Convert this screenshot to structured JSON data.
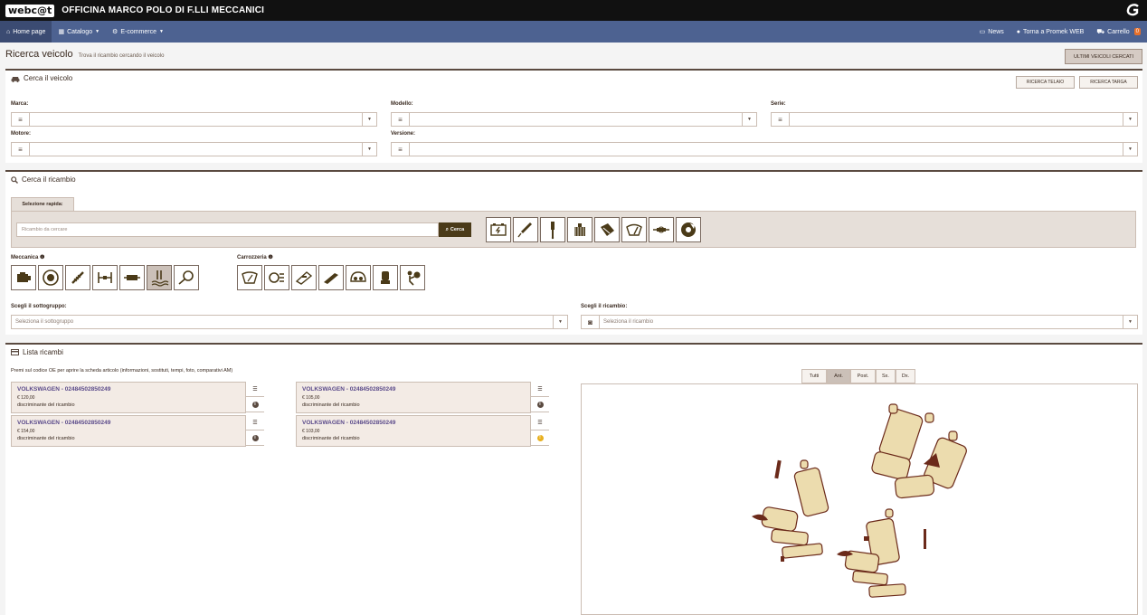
{
  "app": {
    "logo_text": "webc@t",
    "title": "OFFICINA MARCO POLO DI F.LLI MECCANICI"
  },
  "nav": {
    "home": "Home page",
    "catalogo": "Catalogo",
    "ecommerce": "E-commerce",
    "news": "News",
    "torna": "Torna a Promek WEB",
    "carrello": "Carrello",
    "cart_count": "0"
  },
  "page": {
    "title": "Ricerca veicolo",
    "subtitle": "Trova il ricambio cercando il veicolo",
    "last_button": "ULTIMI VEICOLI CERCATI"
  },
  "vehicle": {
    "title": "Cerca il veicolo",
    "btn_telaio": "RICERCA TELAIO",
    "btn_targa": "RICERCA TARGA",
    "marca": "Marca:",
    "modello": "Modello:",
    "serie": "Serie:",
    "motore": "Motore:",
    "versione": "Versione:"
  },
  "part_search": {
    "title": "Cerca il ricambio",
    "quick_tab": "Selezione rapida:",
    "placeholder": "Ricambio da cercare",
    "search_btn": "Cerca",
    "meccanica": "Meccanica",
    "carrozzeria": "Carrozzeria",
    "sottogruppo_label": "Scegli il sottogruppo:",
    "sottogruppo_placeholder": "Seleziona il sottogruppo",
    "ricambio_label": "Scegli il ricambio:",
    "ricambio_placeholder": "Seleziona il ricambio"
  },
  "list": {
    "title": "Lista ricambi",
    "hint": "Premi sul codice OE per aprire la scheda articolo (informazioni, sostituti, tempi, foto, comparativi AM)",
    "items": [
      {
        "title": "VOLKSWAGEN - 02484502850249",
        "price": "€ 120,00",
        "desc": "discriminante del ricambio"
      },
      {
        "title": "VOLKSWAGEN - 02484502850249",
        "price": "€ 105,00",
        "desc": "discriminante del ricambio"
      },
      {
        "title": "VOLKSWAGEN - 02484502850249",
        "price": "€ 154,00",
        "desc": "discriminante del ricambio"
      },
      {
        "title": "VOLKSWAGEN - 02484502850249",
        "price": "€ 103,00",
        "desc": "discriminante del ricambio"
      }
    ],
    "view_tabs": [
      "Tutti",
      "Ant.",
      "Post.",
      "Sx.",
      "Dx."
    ],
    "selected_view": "Ant."
  },
  "colors": {
    "topbar": "#111111",
    "navbar": "#4d6291",
    "accent": "#e8702a",
    "search_btn": "#4a3a18",
    "part_fill": "#ecdcae",
    "part_stroke": "#6b2a1a"
  },
  "icons": {
    "quick": [
      "battery-icon",
      "spark-plug-icon",
      "shock-absorber-icon",
      "oil-filter-icon",
      "exhaust-icon",
      "wiper-icon",
      "injector-icon",
      "brake-disc-icon"
    ],
    "meccanica": [
      "engine-icon",
      "brake-icon",
      "suspension-icon",
      "axle-icon",
      "transmission-icon",
      "cooling-icon",
      "steering-icon"
    ],
    "carrozzeria": [
      "windshield-icon",
      "headlight-icon",
      "door-handle-icon",
      "bumper-icon",
      "dashboard-icon",
      "seat-icon",
      "airbag-icon"
    ]
  }
}
